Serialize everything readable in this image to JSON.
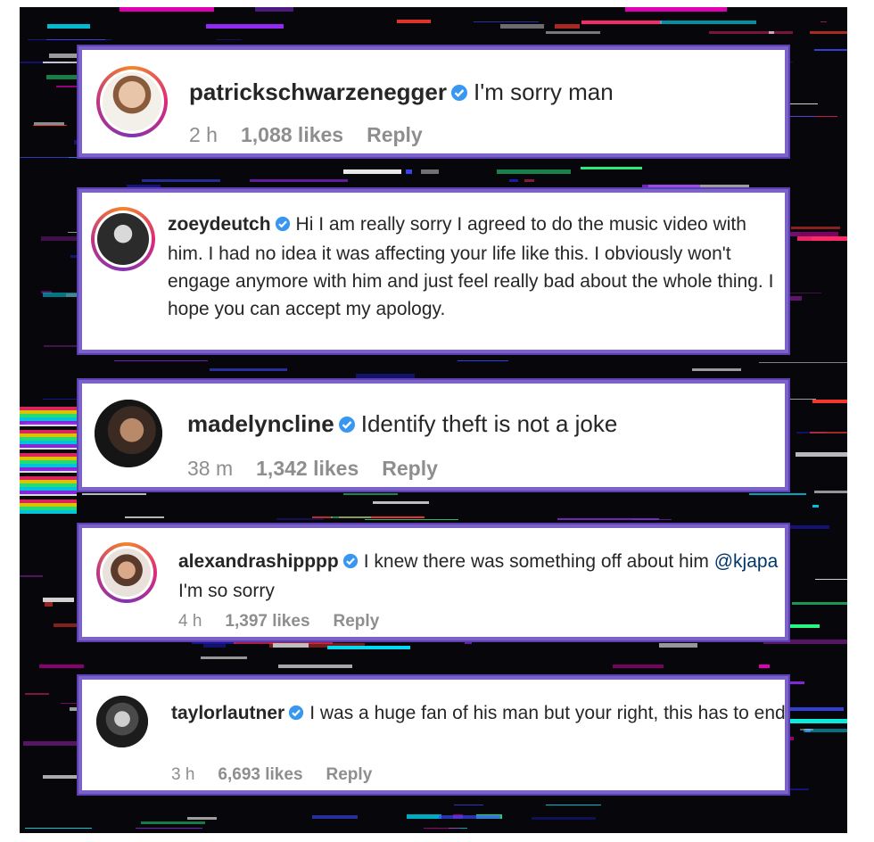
{
  "comments": [
    {
      "username": "patrickschwarzenegger",
      "text": "I'm sorry man",
      "time": "2 h",
      "likes": "1,088 likes",
      "reply": "Reply"
    },
    {
      "username": "zoeydeutch",
      "text": "Hi I am really sorry I agreed to do the music video with him. I had no idea it was affecting your life like this. I obviously won't engage anymore with him and just feel really bad about the whole thing. I hope you can accept my apology."
    },
    {
      "username": "madelyncline",
      "text": "Identify theft is not a joke",
      "time": "38 m",
      "likes": "1,342 likes",
      "reply": "Reply"
    },
    {
      "username": "alexandrashipppp",
      "text_before": "I knew there was something off about him",
      "mention": "@kjapa",
      "text_after": "I'm so sorry",
      "time": "4 h",
      "likes": "1,397 likes",
      "reply": "Reply"
    },
    {
      "username": "taylorlautner",
      "text": "I was a huge fan of his man but your right, this has to end",
      "time": "3 h",
      "likes": "6,693 likes",
      "reply": "Reply"
    }
  ],
  "colors": {
    "card_border": "#7b63c7",
    "verified_badge": "#3897f0",
    "mention": "#00376b",
    "meta": "#8e8e8e"
  }
}
